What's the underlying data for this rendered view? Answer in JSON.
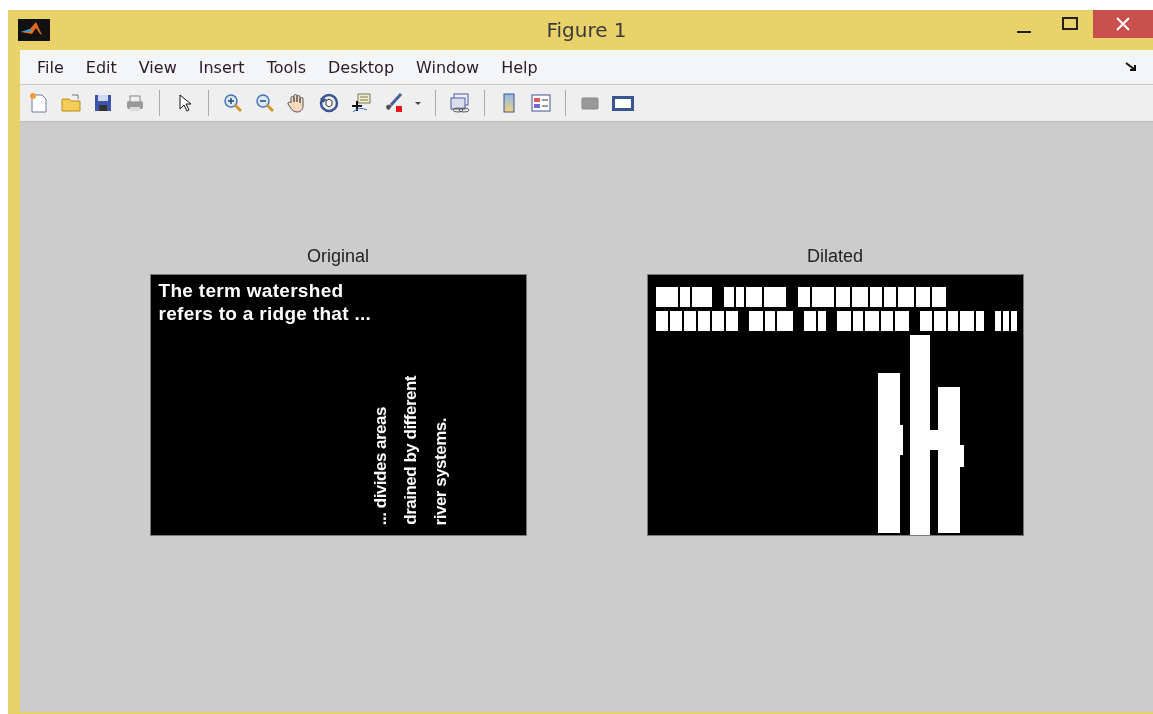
{
  "window": {
    "title": "Figure 1"
  },
  "menu": [
    "File",
    "Edit",
    "View",
    "Insert",
    "Tools",
    "Desktop",
    "Window",
    "Help"
  ],
  "axes": [
    {
      "title": "Original",
      "kind": "text",
      "lines": [
        "The term watershed",
        "refers to a ridge that ..."
      ],
      "vertical_lines": [
        "... divides areas",
        "drained by different",
        "river systems."
      ]
    },
    {
      "title": "Dilated",
      "kind": "dilated"
    }
  ]
}
